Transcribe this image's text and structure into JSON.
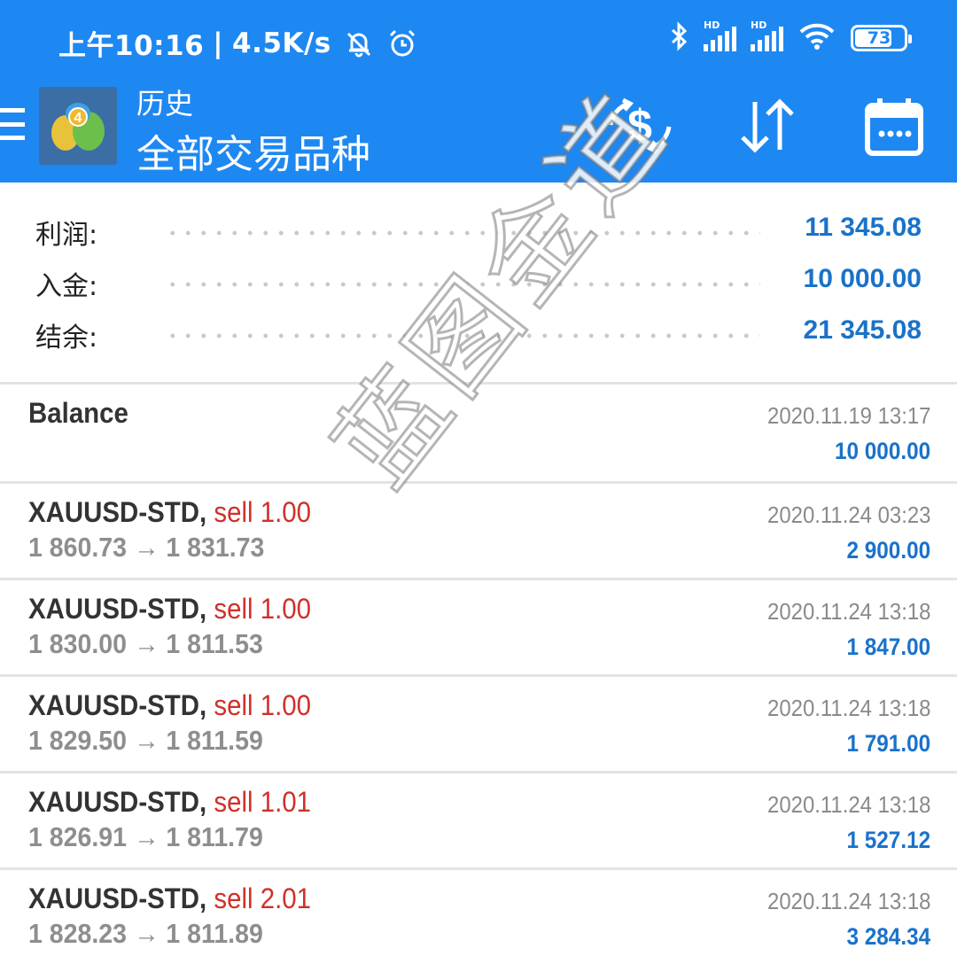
{
  "status_bar": {
    "time": "上午10:16",
    "separator": "|",
    "net_speed": "4.5K/s",
    "signal_1_label": "HD",
    "signal_2_label": "HD",
    "battery": "73"
  },
  "app_bar": {
    "title_small": "历史",
    "title_big": "全部交易品种",
    "icons": [
      "menu-icon",
      "app-logo-icon",
      "currency-exchange-icon",
      "sort-arrows-icon",
      "calendar-icon"
    ]
  },
  "summary": {
    "profit_label": "利润:",
    "profit_value": "11 345.08",
    "deposit_label": "入金:",
    "deposit_value": "10 000.00",
    "balance_label": "结余:",
    "balance_value": "21 345.08"
  },
  "deals": [
    {
      "title": "Balance",
      "sell": "",
      "prices": "",
      "time": "2020.11.19 13:17",
      "profit": "10 000.00"
    },
    {
      "title": "XAUUSD-STD,",
      "sell": "sell 1.00",
      "prices": "1 860.73 → 1 831.73",
      "time": "2020.11.24 03:23",
      "profit": "2 900.00"
    },
    {
      "title": "XAUUSD-STD,",
      "sell": "sell 1.00",
      "prices": "1 830.00 → 1 811.53",
      "time": "2020.11.24 13:18",
      "profit": "1 847.00"
    },
    {
      "title": "XAUUSD-STD,",
      "sell": "sell 1.00",
      "prices": "1 829.50 → 1 811.59",
      "time": "2020.11.24 13:18",
      "profit": "1 791.00"
    },
    {
      "title": "XAUUSD-STD,",
      "sell": "sell 1.01",
      "prices": "1 826.91 → 1 811.79",
      "time": "2020.11.24 13:18",
      "profit": "1 527.12"
    },
    {
      "title": "XAUUSD-STD,",
      "sell": "sell 2.01",
      "prices": "1 828.23 → 1 811.89",
      "time": "2020.11.24 13:18",
      "profit": "3 284.34"
    }
  ],
  "watermark": "蓝图金道",
  "colors": {
    "primary": "#1e88f2",
    "value_blue": "#1a72c9",
    "sell_red": "#d0302a",
    "muted_gray": "#8e8e8e"
  }
}
